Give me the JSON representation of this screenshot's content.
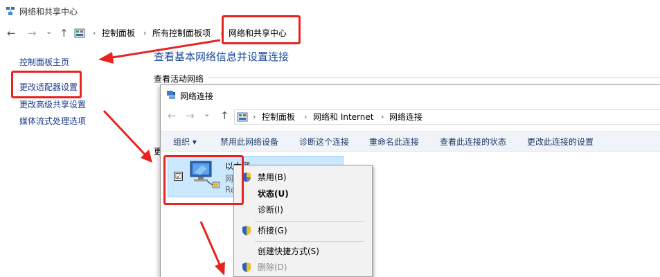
{
  "background_window": {
    "title": "网络和共享中心",
    "breadcrumbs": [
      "控制面板",
      "所有控制面板项",
      "网络和共享中心"
    ],
    "sidebar": [
      {
        "label": "控制面板主页"
      },
      {
        "label": "更改适配器设置"
      },
      {
        "label": "更改高级共享设置"
      },
      {
        "label": "媒体流式处理选项"
      }
    ],
    "heading": "查看基本网络信息并设置连接",
    "active_networks_label": "查看活动网络",
    "partial_text": "更"
  },
  "network_connections_window": {
    "title": "网络连接",
    "breadcrumbs": [
      "控制面板",
      "网络和 Internet",
      "网络连接"
    ],
    "toolbar": {
      "organize": "组织 ▾",
      "items": [
        "禁用此网络设备",
        "诊断这个连接",
        "重命名此连接",
        "查看此连接的状态",
        "更改此连接的设置"
      ]
    },
    "adapter": {
      "name": "以太网",
      "line2": "网络",
      "line3": "Realtek",
      "checked_mark": "☑"
    }
  },
  "context_menu": {
    "items": [
      {
        "label": "禁用(B)",
        "icon": "shield-icon",
        "style": "normal"
      },
      {
        "label": "状态(U)",
        "icon": "",
        "style": "bold"
      },
      {
        "label": "诊断(I)",
        "icon": "",
        "style": "normal"
      },
      {
        "label": "桥接(G)",
        "icon": "shield-icon",
        "style": "normal"
      },
      {
        "label": "创建快捷方式(S)",
        "icon": "",
        "style": "normal"
      },
      {
        "label": "删除(D)",
        "icon": "shield-icon",
        "style": "disabled"
      }
    ]
  },
  "nav_glyphs": {
    "back": "←",
    "forward": "→",
    "recent": "⌄",
    "up": "↑",
    "sep": "›"
  },
  "colors": {
    "annotation_red": "#e8231f",
    "link_blue": "#1a3a8f",
    "selection": "#cce8ff"
  }
}
